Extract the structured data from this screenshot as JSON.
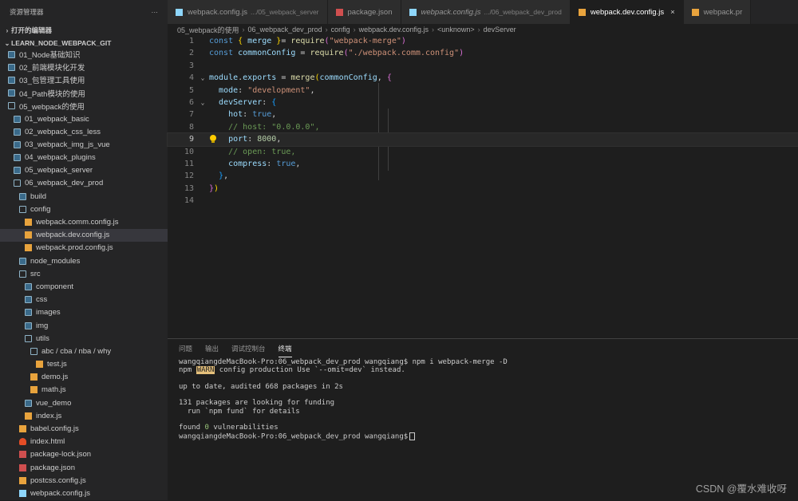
{
  "explorer": {
    "title": "资源管理器",
    "more": "···",
    "open_editors": "打开的编辑器",
    "project": "LEARN_NODE_WEBPACK_GIT"
  },
  "tree": [
    {
      "label": "01_Node基础知识",
      "icon": "folder",
      "indent": 0
    },
    {
      "label": "02_前端模块化开发",
      "icon": "folder",
      "indent": 0
    },
    {
      "label": "03_包管理工具使用",
      "icon": "folder",
      "indent": 0
    },
    {
      "label": "04_Path模块的使用",
      "icon": "folder",
      "indent": 0
    },
    {
      "label": "05_webpack的使用",
      "icon": "folder-open",
      "indent": 0
    },
    {
      "label": "01_webpack_basic",
      "icon": "folder",
      "indent": 1
    },
    {
      "label": "02_webpack_css_less",
      "icon": "folder",
      "indent": 1
    },
    {
      "label": "03_webpack_img_js_vue",
      "icon": "folder",
      "indent": 1
    },
    {
      "label": "04_webpack_plugins",
      "icon": "folder",
      "indent": 1
    },
    {
      "label": "05_webpack_server",
      "icon": "folder",
      "indent": 1
    },
    {
      "label": "06_webpack_dev_prod",
      "icon": "folder-open",
      "indent": 1
    },
    {
      "label": "build",
      "icon": "folder",
      "indent": 2
    },
    {
      "label": "config",
      "icon": "folder-open",
      "indent": 2
    },
    {
      "label": "webpack.comm.config.js",
      "icon": "js",
      "indent": 3
    },
    {
      "label": "webpack.dev.config.js",
      "icon": "js",
      "indent": 3,
      "active": true
    },
    {
      "label": "webpack.prod.config.js",
      "icon": "js",
      "indent": 3
    },
    {
      "label": "node_modules",
      "icon": "folder",
      "indent": 2
    },
    {
      "label": "src",
      "icon": "folder-open",
      "indent": 2
    },
    {
      "label": "component",
      "icon": "folder",
      "indent": 3
    },
    {
      "label": "css",
      "icon": "folder",
      "indent": 3
    },
    {
      "label": "images",
      "icon": "folder",
      "indent": 3
    },
    {
      "label": "img",
      "icon": "folder",
      "indent": 3
    },
    {
      "label": "utils",
      "icon": "folder-open",
      "indent": 3
    },
    {
      "label": "abc / cba / nba / why",
      "icon": "folder-open",
      "indent": 4
    },
    {
      "label": "test.js",
      "icon": "js",
      "indent": 5
    },
    {
      "label": "demo.js",
      "icon": "js",
      "indent": 4
    },
    {
      "label": "math.js",
      "icon": "js",
      "indent": 4
    },
    {
      "label": "vue_demo",
      "icon": "folder",
      "indent": 3
    },
    {
      "label": "index.js",
      "icon": "js",
      "indent": 3
    },
    {
      "label": "babel.config.js",
      "icon": "cfg",
      "indent": 2
    },
    {
      "label": "index.html",
      "icon": "html",
      "indent": 2
    },
    {
      "label": "package-lock.json",
      "icon": "json",
      "indent": 2
    },
    {
      "label": "package.json",
      "icon": "json",
      "indent": 2
    },
    {
      "label": "postcss.config.js",
      "icon": "cfg",
      "indent": 2
    },
    {
      "label": "webpack.config.js",
      "icon": "webpack",
      "indent": 2
    }
  ],
  "tabs": [
    {
      "name": "webpack.config.js",
      "desc": ".../05_webpack_server",
      "icon": "webpack",
      "italic": false,
      "active": false
    },
    {
      "name": "package.json",
      "desc": "",
      "icon": "json",
      "italic": false,
      "active": false
    },
    {
      "name": "webpack.config.js",
      "desc": ".../06_webpack_dev_prod",
      "icon": "webpack",
      "italic": true,
      "active": false
    },
    {
      "name": "webpack.dev.config.js",
      "desc": "",
      "icon": "js",
      "italic": false,
      "active": true,
      "close": "×"
    },
    {
      "name": "webpack.pr",
      "desc": "",
      "icon": "js",
      "italic": false,
      "active": false
    }
  ],
  "breadcrumb": [
    "05_webpack的使用",
    "06_webpack_dev_prod",
    "config",
    "webpack.dev.config.js",
    "<unknown>",
    "devServer"
  ],
  "lines": [
    {
      "n": "1",
      "fold": "",
      "tokens": [
        [
          "kw",
          "const "
        ],
        [
          "br1",
          "{ "
        ],
        [
          "var",
          "merge"
        ],
        [
          "br1",
          " }"
        ],
        [
          "",
          "= "
        ],
        [
          "fn",
          "require"
        ],
        [
          "br2",
          "("
        ],
        [
          "str",
          "\"webpack-merge\""
        ],
        [
          "br2",
          ")"
        ]
      ]
    },
    {
      "n": "2",
      "fold": "",
      "tokens": [
        [
          "kw",
          "const "
        ],
        [
          "var",
          "commonConfig"
        ],
        [
          "",
          " = "
        ],
        [
          "fn",
          "require"
        ],
        [
          "br2",
          "("
        ],
        [
          "str",
          "\"./webpack.comm.config\""
        ],
        [
          "br2",
          ")"
        ]
      ]
    },
    {
      "n": "3",
      "fold": "",
      "tokens": []
    },
    {
      "n": "4",
      "fold": "⌄",
      "tokens": [
        [
          "var",
          "module"
        ],
        [
          "",
          "."
        ],
        [
          "var",
          "exports"
        ],
        [
          "",
          " = "
        ],
        [
          "fn",
          "merge"
        ],
        [
          "br1",
          "("
        ],
        [
          "var",
          "commonConfig"
        ],
        [
          ",",
          ", "
        ],
        [
          "br2",
          "{"
        ]
      ]
    },
    {
      "n": "5",
      "fold": "",
      "tokens": [
        [
          "",
          "  "
        ],
        [
          "var",
          "mode"
        ],
        [
          "",
          ": "
        ],
        [
          "str",
          "\"development\""
        ],
        [
          "",
          ","
        ]
      ]
    },
    {
      "n": "6",
      "fold": "⌄",
      "tokens": [
        [
          "",
          "  "
        ],
        [
          "var",
          "devServer"
        ],
        [
          "",
          ": "
        ],
        [
          "br3",
          "{"
        ]
      ]
    },
    {
      "n": "7",
      "fold": "",
      "tokens": [
        [
          "",
          "    "
        ],
        [
          "var",
          "hot"
        ],
        [
          "",
          ": "
        ],
        [
          "kw",
          "true"
        ],
        [
          "",
          ","
        ]
      ]
    },
    {
      "n": "8",
      "fold": "",
      "tokens": [
        [
          "",
          "    "
        ],
        [
          "cmt",
          "// host: \"0.0.0.0\","
        ]
      ]
    },
    {
      "n": "9",
      "fold": "",
      "current": true,
      "bulb": true,
      "tokens": [
        [
          "",
          "    "
        ],
        [
          "var",
          "port"
        ],
        [
          "",
          ": "
        ],
        [
          "num",
          "8000"
        ],
        [
          "",
          ","
        ]
      ]
    },
    {
      "n": "10",
      "fold": "",
      "tokens": [
        [
          "",
          "    "
        ],
        [
          "cmt",
          "// open: true,"
        ]
      ]
    },
    {
      "n": "11",
      "fold": "",
      "tokens": [
        [
          "",
          "    "
        ],
        [
          "var",
          "compress"
        ],
        [
          "",
          ": "
        ],
        [
          "kw",
          "true"
        ],
        [
          "",
          ","
        ]
      ]
    },
    {
      "n": "12",
      "fold": "",
      "tokens": [
        [
          "",
          "  "
        ],
        [
          "br3",
          "}"
        ],
        [
          "",
          ","
        ]
      ]
    },
    {
      "n": "13",
      "fold": "",
      "tokens": [
        [
          "br2",
          "}"
        ],
        [
          "br1",
          ")"
        ]
      ]
    },
    {
      "n": "14",
      "fold": "",
      "tokens": []
    }
  ],
  "panel_tabs": [
    {
      "label": "问题",
      "active": false
    },
    {
      "label": "输出",
      "active": false
    },
    {
      "label": "调试控制台",
      "active": false
    },
    {
      "label": "终端",
      "active": true
    }
  ],
  "terminal": {
    "l1": "wangqiangdeMacBook-Pro:06_webpack_dev_prod wangqiang$ npm i webpack-merge -D",
    "l2_pre": "npm ",
    "l2_warn": "WARN",
    "l2_post": " config production Use `--omit=dev` instead.",
    "l3": "",
    "l4": "up to date, audited 668 packages in 2s",
    "l5": "",
    "l6": "131 packages are looking for funding",
    "l7": "  run `npm fund` for details",
    "l8": "",
    "l9_pre": "found ",
    "l9_num": "0",
    "l9_post": " vulnerabilities",
    "l10": "wangqiangdeMacBook-Pro:06_webpack_dev_prod wangqiang$"
  },
  "watermark": "CSDN @覆水难收呀",
  "colors": {
    "background": "#1e1e1e",
    "sidebar": "#252526",
    "accent": "#569cd6"
  }
}
